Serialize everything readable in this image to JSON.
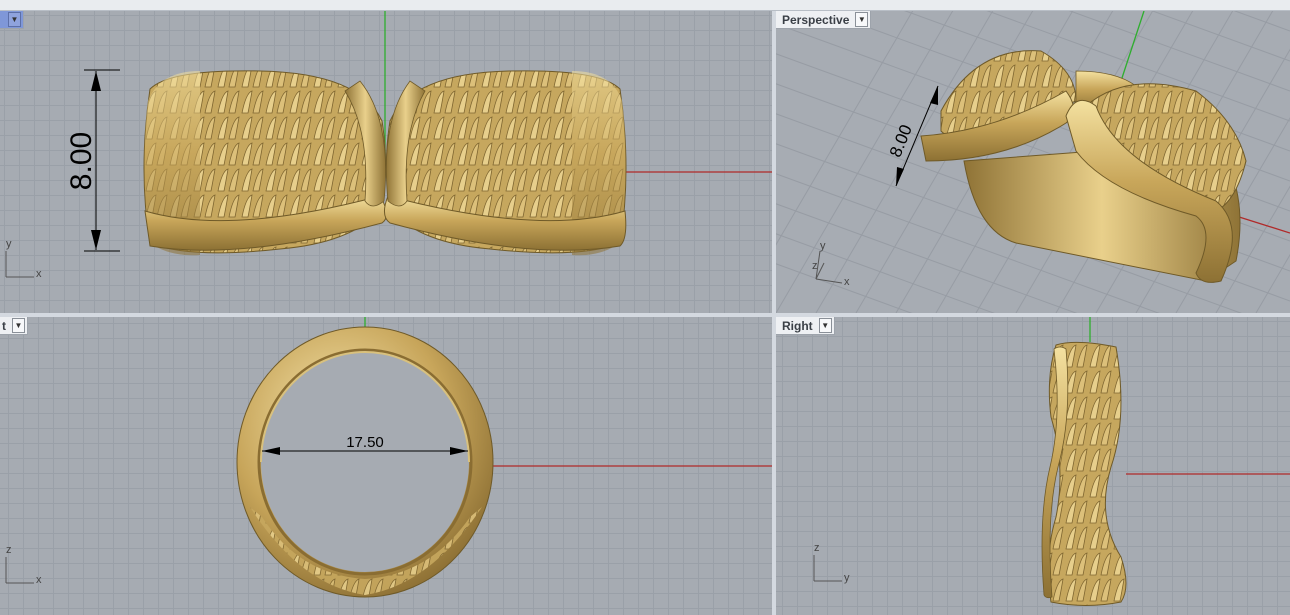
{
  "viewports": {
    "top": {
      "title": "",
      "dimension": "8.00",
      "axis": {
        "vertical": "y",
        "horizontal": "x"
      }
    },
    "perspective": {
      "title": "Perspective",
      "dimension": "8.00",
      "axis": {
        "vertical": "y",
        "depth": "z",
        "horizontal": "x"
      }
    },
    "front": {
      "title": "t",
      "dimension": "17.50",
      "axis": {
        "vertical": "z",
        "horizontal": "x"
      }
    },
    "right": {
      "title": "Right",
      "axis": {
        "vertical": "z",
        "horizontal": "y"
      }
    }
  },
  "icons": {
    "dropdown": "chevron-down-icon"
  },
  "colors": {
    "grid_background": "#a6abb2",
    "active_viewport_title": "#7f97d8",
    "gold_model": "#c9ae62",
    "x_axis": "#b02a2a",
    "y_axis": "#2eae2e"
  }
}
